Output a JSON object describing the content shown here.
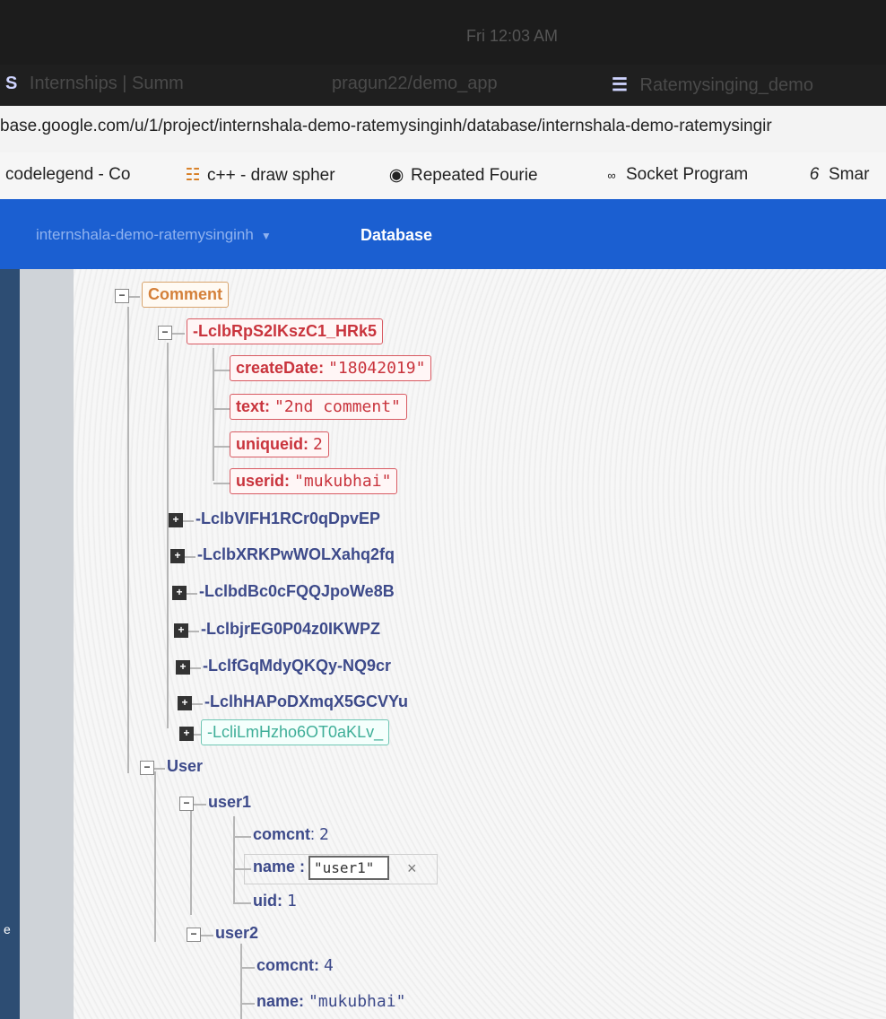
{
  "system": {
    "clock": "Fri 12:03 AM"
  },
  "tabs": [
    {
      "label": "Internships | Summ",
      "icon": "S"
    },
    {
      "label": "pragun22/demo_app"
    },
    {
      "label": "Ratemysinging_demo",
      "icon": "doc-icon"
    }
  ],
  "address": {
    "url": "base.google.com/u/1/project/internshala-demo-ratemysinginh/database/internshala-demo-ratemysingir"
  },
  "bookmarks": [
    {
      "label": "codelegend - Co",
      "icon": ""
    },
    {
      "label": "c++ - draw spher",
      "icon": "stack-icon"
    },
    {
      "label": "Repeated Fourie",
      "icon": "circle-icon"
    },
    {
      "label": "Socket Program",
      "icon": "gg-icon"
    },
    {
      "label": "Smar",
      "icon": "6-icon"
    }
  ],
  "header": {
    "project": "internshala-demo-ratemysinginh",
    "section": "Database"
  },
  "tree": {
    "comment_label": "Comment",
    "expanded_key": "-LclbRpS2lKszC1_HRk5",
    "fields": [
      {
        "key": "createDate",
        "value": "\"18042019\""
      },
      {
        "key": "text",
        "value": "\"2nd comment\""
      },
      {
        "key": "uniqueid",
        "value": "2"
      },
      {
        "key": "userid",
        "value": "\"mukubhai\""
      }
    ],
    "collapsed": [
      "-LclbVIFH1RCr0qDpvEP",
      "-LclbXRKPwWOLXahq2fq",
      "-LclbdBc0cFQQJpoWe8B",
      "-LclbjrEG0P04z0IKWPZ",
      "-LclfGqMdyQKQy-NQ9cr",
      "-LclhHAPoDXmqX5GCVYu",
      "-LcliLmHzho6OT0aKLv_"
    ],
    "user_label": "User",
    "user1": {
      "label": "user1",
      "comcnt_key": "comcnt",
      "comcnt_val": "2",
      "name_key": "name",
      "name_val": "\"user1\"",
      "uid_key": "uid",
      "uid_val": "1"
    },
    "user2": {
      "label": "user2",
      "comcnt_key": "comcnt",
      "comcnt_val": "4",
      "name_key": "name",
      "name_val": "\"mukubhai\""
    },
    "close_symbol": "×"
  }
}
